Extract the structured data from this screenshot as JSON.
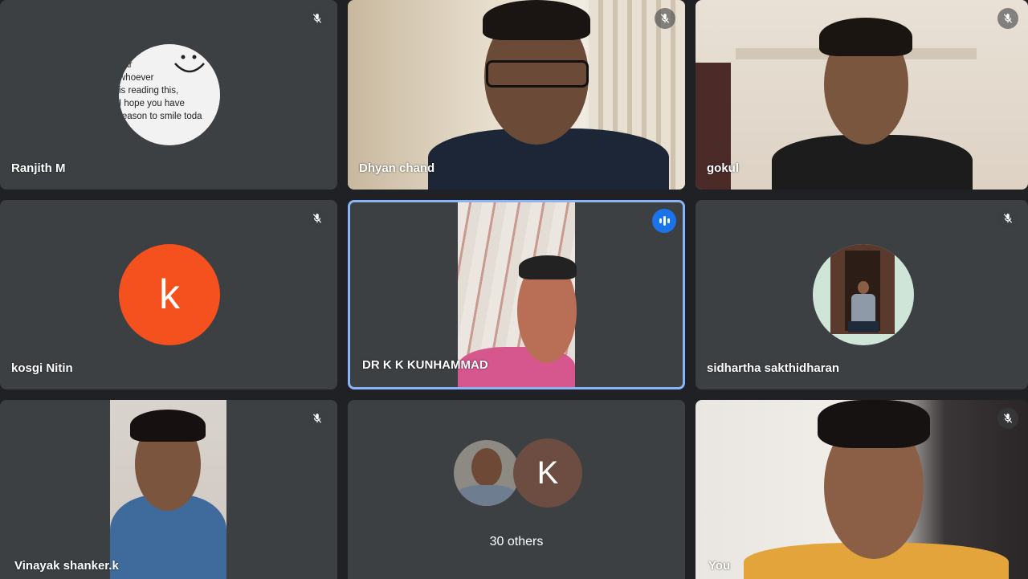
{
  "tiles": [
    {
      "name": "Ranjith M",
      "mic": "mic-off-icon"
    },
    {
      "name": "Dhyan chand",
      "mic": "mic-off-icon"
    },
    {
      "name": "gokul",
      "mic": "mic-off-icon"
    },
    {
      "name": "kosgi Nitin",
      "mic": "mic-off-icon",
      "initial": "k",
      "avatar_color": "#f4511e"
    },
    {
      "name": "DR K K KUNHAMMAD",
      "mic": "speaking-icon"
    },
    {
      "name": "sidhartha sakthidharan",
      "mic": "mic-off-icon"
    },
    {
      "name": "Vinayak shanker.k",
      "mic": "mic-off-icon"
    },
    {
      "others_label": "30 others",
      "initial": "K",
      "avatar_color": "#6d4c41"
    },
    {
      "name": "You",
      "mic": "mic-off-icon"
    }
  ],
  "ranjith_avatar_text": [
    "ear",
    "whoever",
    "is reading this,",
    "I hope you have",
    "reason to smile toda"
  ],
  "colors": {
    "background": "#202124",
    "tile": "#3c4043",
    "active_border": "#8ab4f8",
    "speaking": "#1a73e8"
  }
}
